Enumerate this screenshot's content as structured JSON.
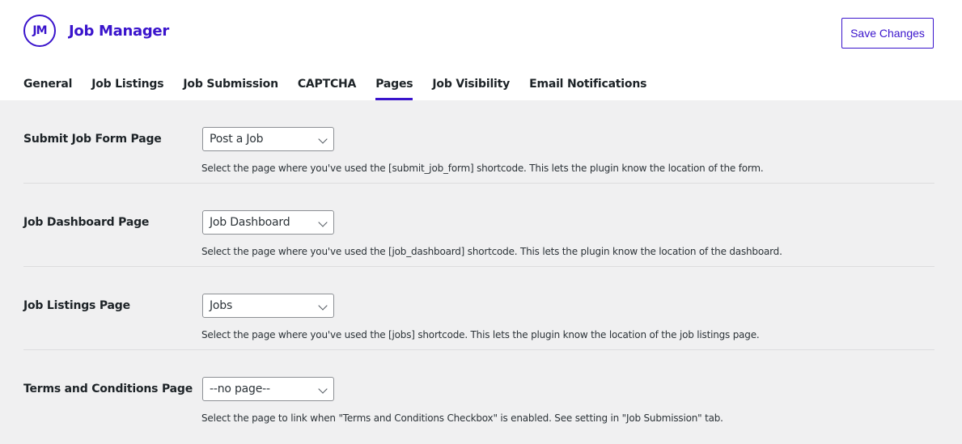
{
  "header": {
    "logo_text": "JM",
    "app_name": "Job Manager",
    "save_label": "Save Changes"
  },
  "tabs": [
    {
      "label": "General"
    },
    {
      "label": "Job Listings"
    },
    {
      "label": "Job Submission"
    },
    {
      "label": "CAPTCHA"
    },
    {
      "label": "Pages",
      "active": true
    },
    {
      "label": "Job Visibility"
    },
    {
      "label": "Email Notifications"
    }
  ],
  "settings": [
    {
      "label": "Submit Job Form Page",
      "value": "Post a Job",
      "description": "Select the page where you've used the [submit_job_form] shortcode. This lets the plugin know the location of the form."
    },
    {
      "label": "Job Dashboard Page",
      "value": "Job Dashboard",
      "description": "Select the page where you've used the [job_dashboard] shortcode. This lets the plugin know the location of the dashboard."
    },
    {
      "label": "Job Listings Page",
      "value": "Jobs",
      "description": "Select the page where you've used the [jobs] shortcode. This lets the plugin know the location of the job listings page."
    },
    {
      "label": "Terms and Conditions Page",
      "value": "--no page--",
      "description": "Select the page to link when \"Terms and Conditions Checkbox\" is enabled. See setting in \"Job Submission\" tab."
    }
  ],
  "colors": {
    "accent": "#3a14cc",
    "background": "#f0f0f1"
  }
}
